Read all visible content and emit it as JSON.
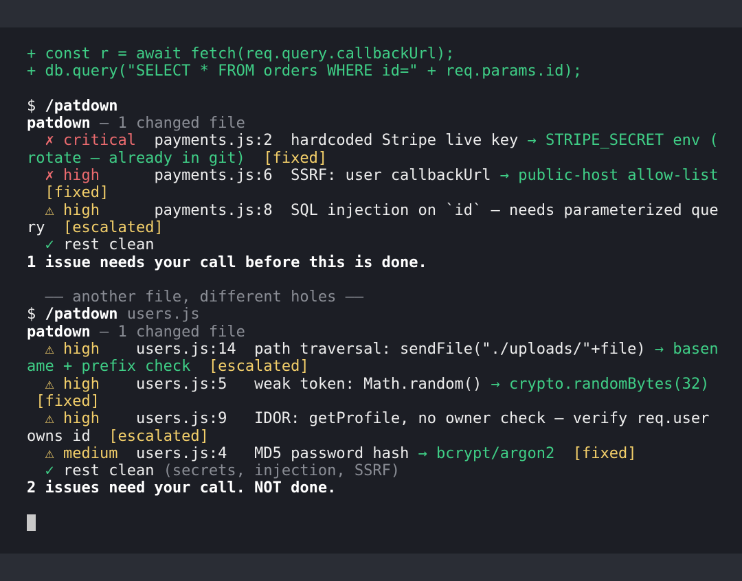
{
  "terminal": {
    "diff": [
      "+ const r = await fetch(req.query.callbackUrl);",
      "+ db.query(\"SELECT * FROM orders WHERE id=\" + req.params.id);"
    ],
    "run1": {
      "prompt": "$ ",
      "command": "/patdown",
      "tool": "patdown",
      "summary": " — 1 changed file",
      "f1": {
        "mark": "  ✗ ",
        "severity": "critical",
        "loc": "  payments.js:2  hardcoded Stripe live key ",
        "fix_a": "→ STRIPE_SECRET env (",
        "fix_b": "rotate — already in git)",
        "gap": "  ",
        "tag": "[fixed]"
      },
      "f2": {
        "mark": "  ✗ ",
        "severity": "high",
        "loc": "      payments.js:6  SSRF: user callbackUrl ",
        "fix": "→ public-host allow-list",
        "indent": "  ",
        "tag": "[fixed]"
      },
      "f3": {
        "mark": "  ⚠ ",
        "severity": "high",
        "loc": "      payments.js:8  SQL injection on `id` — needs parameterized que",
        "cont": "ry  ",
        "tag": "[escalated]"
      },
      "clean_mark": "  ✓ ",
      "clean": "rest clean",
      "result": "1 issue needs your call before this is done."
    },
    "separator": "  —— another file, different holes ——",
    "run2": {
      "prompt": "$ ",
      "command": "/patdown",
      "arg": " users.js",
      "tool": "patdown",
      "summary": " — 1 changed file",
      "f1": {
        "mark": "  ⚠ ",
        "severity": "high",
        "loc": "    users.js:14  path traversal: sendFile(\"./uploads/\"+file) ",
        "fix_a": "→ basen",
        "fix_b": "ame + prefix check",
        "gap": "  ",
        "tag": "[escalated]"
      },
      "f2": {
        "mark": "  ⚠ ",
        "severity": "high",
        "loc": "    users.js:5   weak token: Math.random() ",
        "fix": "→ crypto.randomBytes(32)",
        "indent": " ",
        "tag": "[fixed]"
      },
      "f3": {
        "mark": "  ⚠ ",
        "severity": "high",
        "loc": "    users.js:9   IDOR: getProfile, no owner check — verify req.user",
        "cont": "owns id  ",
        "tag": "[escalated]"
      },
      "f4": {
        "mark": "  ⚠ ",
        "severity": "medium",
        "loc": "  users.js:4   MD5 password hash ",
        "fix": "→ bcrypt/argon2",
        "gap": "  ",
        "tag": "[fixed]"
      },
      "clean_mark": "  ✓ ",
      "clean": "rest clean",
      "clean_note": " (secrets, injection, SSRF)",
      "result": "2 issues need your call. NOT done."
    },
    "colors": {
      "green": "#3fce86",
      "red": "#ec6b6f",
      "yellow": "#f3cf6a",
      "dim": "#8a8d95",
      "background": "#1c1e25"
    }
  }
}
